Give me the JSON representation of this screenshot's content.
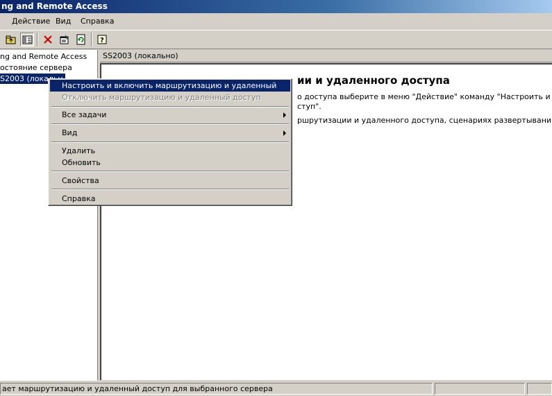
{
  "window": {
    "title": "ng and Remote Access"
  },
  "menu": {
    "items": [
      "Действие",
      "Вид",
      "Справка"
    ]
  },
  "toolbar": {
    "buttons": [
      "up-folder-icon",
      "show-hide-tree-icon",
      "delete-icon",
      "properties-icon",
      "refresh-icon",
      "help-icon"
    ]
  },
  "tree": {
    "root": "ng and Remote Access",
    "status": "остояние сервера",
    "server": "S2003 (локальн"
  },
  "details": {
    "header": "SS2003 (локально)",
    "heading": "ии и удаленного доступа",
    "line1": "о доступа выберите в меню \"Действие\" команду \"Настроить и",
    "line2": "ступ\".",
    "line3": "ршрутизации и удаленного доступа, сценариях развертывания"
  },
  "context_menu": {
    "configure": "Настроить и включить маршрутизацию и удаленный доступ",
    "disable": "Отключить маршрутизацию и удаленный доступ",
    "all_tasks": "Все задачи",
    "view": "Вид",
    "delete": "Удалить",
    "refresh": "Обновить",
    "properties": "Свойства",
    "help": "Справка"
  },
  "status": {
    "text": "ает маршрутизацию и удаленный доступ для выбранного сервера"
  },
  "colors": {
    "selection": "#0a246a",
    "face": "#d4d0c8",
    "title_start": "#0a246a"
  }
}
